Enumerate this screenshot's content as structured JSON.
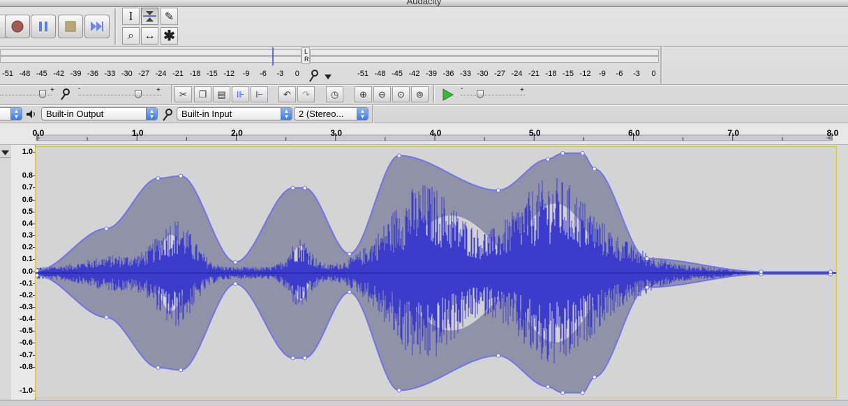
{
  "window": {
    "title": "Audacity"
  },
  "tools": {
    "selection": "I",
    "envelope": "⌇",
    "draw": "✎",
    "zoom": "⌕",
    "timeshift": "↔",
    "multi": "✱",
    "active": "envelope"
  },
  "meters": {
    "left_channel": "L",
    "right_channel": "R",
    "output_ticks": [
      "-51",
      "-48",
      "-45",
      "-42",
      "-39",
      "-36",
      "-33",
      "-30",
      "-27",
      "-24",
      "-21",
      "-18",
      "-15",
      "-12",
      "-9",
      "-6",
      "-3",
      "0"
    ],
    "input_ticks": [
      "-51",
      "-48",
      "-45",
      "-42",
      "-39",
      "-36",
      "-33",
      "-30",
      "-27",
      "-24",
      "-21",
      "-18",
      "-15",
      "-12",
      "-9",
      "-6",
      "-3",
      "0"
    ]
  },
  "mixer": {
    "output_volume": 0.92,
    "input_volume": 0.78,
    "play_speed": 0.3
  },
  "devices": {
    "output_device": "Built-in Output",
    "input_device": "Built-in Input",
    "channels": "2 (Stereo..."
  },
  "timeline": {
    "ticks": [
      "0.0",
      "1.0",
      "2.0",
      "3.0",
      "4.0",
      "5.0",
      "6.0",
      "7.0",
      "8.0"
    ]
  },
  "track": {
    "amplitude_labels": [
      "1.0",
      "0.8",
      "0.7",
      "0.6",
      "0.5",
      "0.4",
      "0.3",
      "0.2",
      "0.1",
      "0.0",
      "-0.1",
      "-0.2",
      "-0.3",
      "-0.4",
      "-0.5",
      "-0.6",
      "-0.7",
      "-0.8",
      "-1.0"
    ],
    "wave_color": "#3c3ccc",
    "envelope_color": "#6f74e6",
    "envelope_fill": "#9093a8",
    "envelope_points": [
      {
        "t": 0.0,
        "v": 0.02
      },
      {
        "t": 0.7,
        "v": 0.37
      },
      {
        "t": 1.22,
        "v": 0.79
      },
      {
        "t": 1.45,
        "v": 0.81
      },
      {
        "t": 2.0,
        "v": 0.09
      },
      {
        "t": 2.58,
        "v": 0.71
      },
      {
        "t": 2.7,
        "v": 0.71
      },
      {
        "t": 3.15,
        "v": 0.16
      },
      {
        "t": 3.65,
        "v": 0.98
      },
      {
        "t": 4.65,
        "v": 0.69
      },
      {
        "t": 5.15,
        "v": 0.95
      },
      {
        "t": 5.3,
        "v": 1.0
      },
      {
        "t": 5.5,
        "v": 1.0
      },
      {
        "t": 5.62,
        "v": 0.87
      },
      {
        "t": 6.15,
        "v": 0.12
      },
      {
        "t": 7.3,
        "v": 0.01
      },
      {
        "t": 8.0,
        "v": 0.01
      }
    ]
  }
}
